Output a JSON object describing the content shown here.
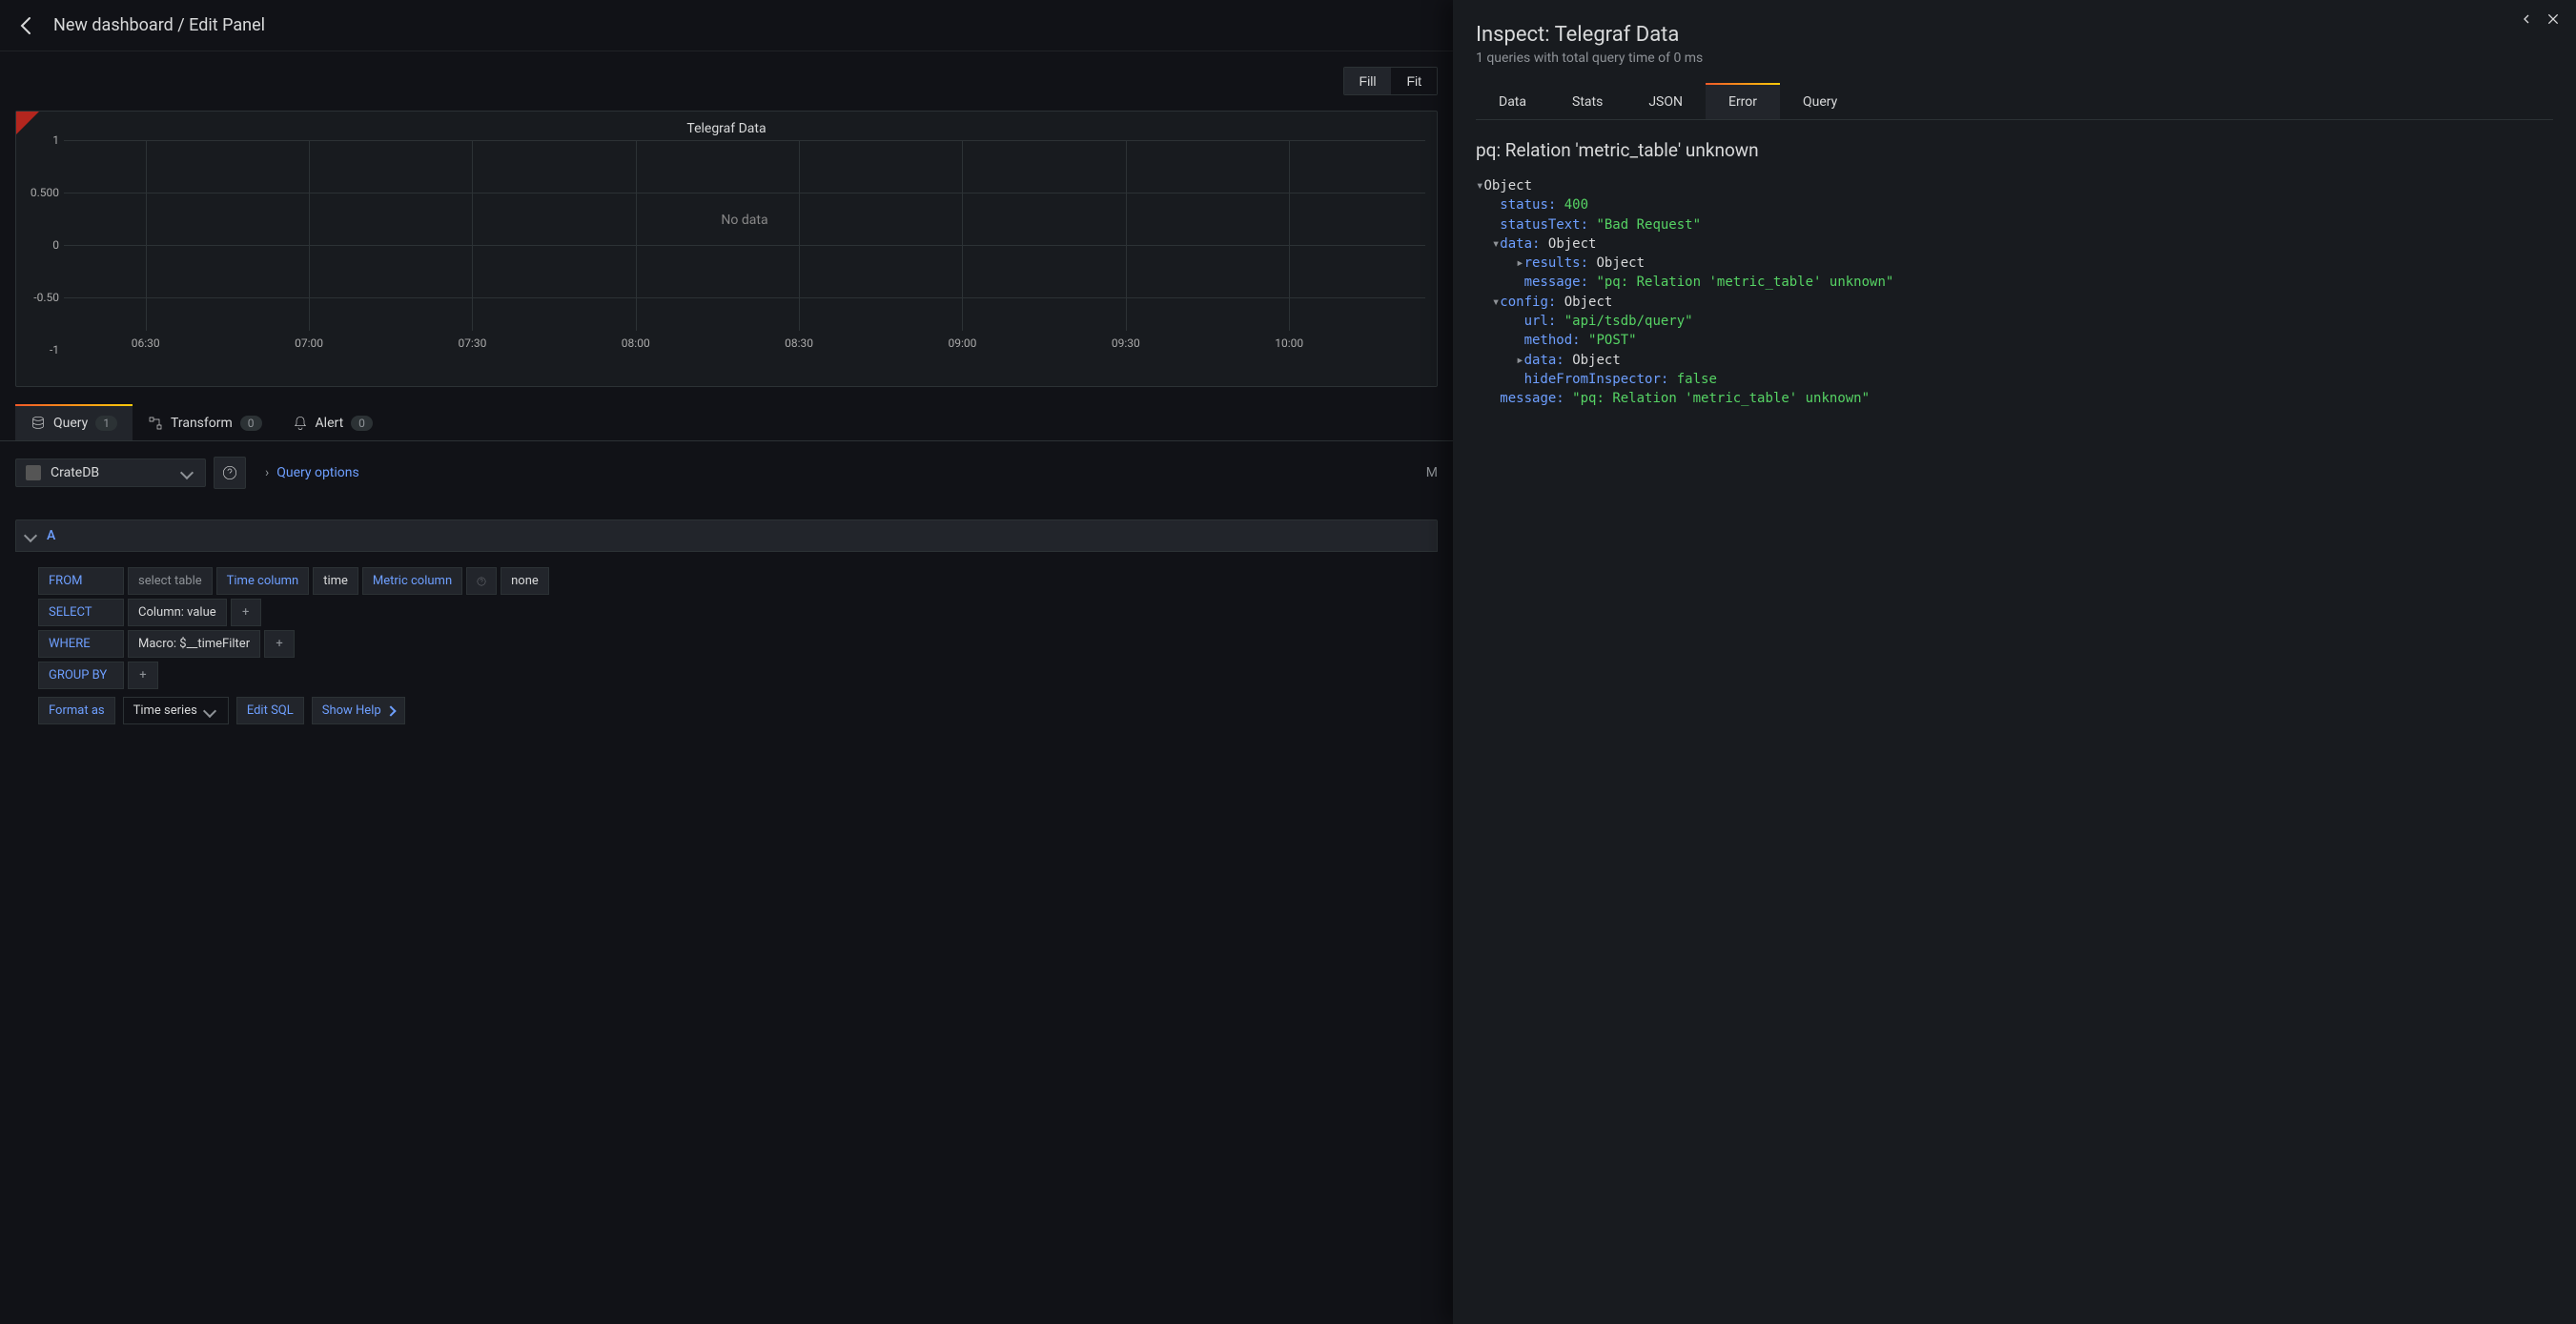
{
  "header": {
    "title": "New dashboard / Edit Panel"
  },
  "toolbar": {
    "fill": "Fill",
    "fit": "Fit"
  },
  "panel": {
    "title": "Telegraf Data",
    "no_data": "No data"
  },
  "chart_data": {
    "type": "line",
    "series": [],
    "title": "Telegraf Data",
    "xlabel": "",
    "ylabel": "",
    "ylim": [
      -1,
      1
    ],
    "y_ticks": [
      "1",
      "0.500",
      "0",
      "-0.50",
      "-1"
    ],
    "x_ticks": [
      "06:30",
      "07:00",
      "07:30",
      "08:00",
      "08:30",
      "09:00",
      "09:30",
      "10:00"
    ],
    "no_data": true
  },
  "tabs": {
    "query": {
      "label": "Query",
      "count": "1"
    },
    "transform": {
      "label": "Transform",
      "count": "0"
    },
    "alert": {
      "label": "Alert",
      "count": "0"
    }
  },
  "datasource": {
    "name": "CrateDB",
    "query_options": "Query options",
    "md": "M"
  },
  "query": {
    "letter": "A",
    "from": {
      "label": "FROM",
      "table": "select table",
      "time_col_lbl": "Time column",
      "time_col_val": "time",
      "metric_col_lbl": "Metric column",
      "metric_col_val": "none"
    },
    "select": {
      "label": "SELECT",
      "column": "Column: value"
    },
    "where": {
      "label": "WHERE",
      "macro": "Macro: $__timeFilter"
    },
    "groupby": {
      "label": "GROUP BY"
    },
    "format": {
      "label": "Format as",
      "value": "Time series",
      "edit_sql": "Edit SQL",
      "show_help": "Show Help"
    }
  },
  "inspector": {
    "title": "Inspect: Telegraf Data",
    "subtitle": "1 queries with total query time of 0 ms",
    "tabs": {
      "data": "Data",
      "stats": "Stats",
      "json": "JSON",
      "error": "Error",
      "query": "Query"
    },
    "error_heading": "pq: Relation 'metric_table' unknown",
    "json": {
      "root": "Object",
      "status_k": "status:",
      "status_v": "400",
      "statusText_k": "statusText:",
      "statusText_v": "\"Bad Request\"",
      "data_k": "data:",
      "data_v": "Object",
      "results_k": "results:",
      "results_v": "Object",
      "message_k": "message:",
      "message_v": "\"pq: Relation 'metric_table' unknown\"",
      "config_k": "config:",
      "config_v": "Object",
      "url_k": "url:",
      "url_v": "\"api/tsdb/query\"",
      "method_k": "method:",
      "method_v": "\"POST\"",
      "data2_k": "data:",
      "data2_v": "Object",
      "hide_k": "hideFromInspector:",
      "hide_v": "false",
      "message2_k": "message:",
      "message2_v": "\"pq: Relation 'metric_table' unknown\""
    }
  }
}
